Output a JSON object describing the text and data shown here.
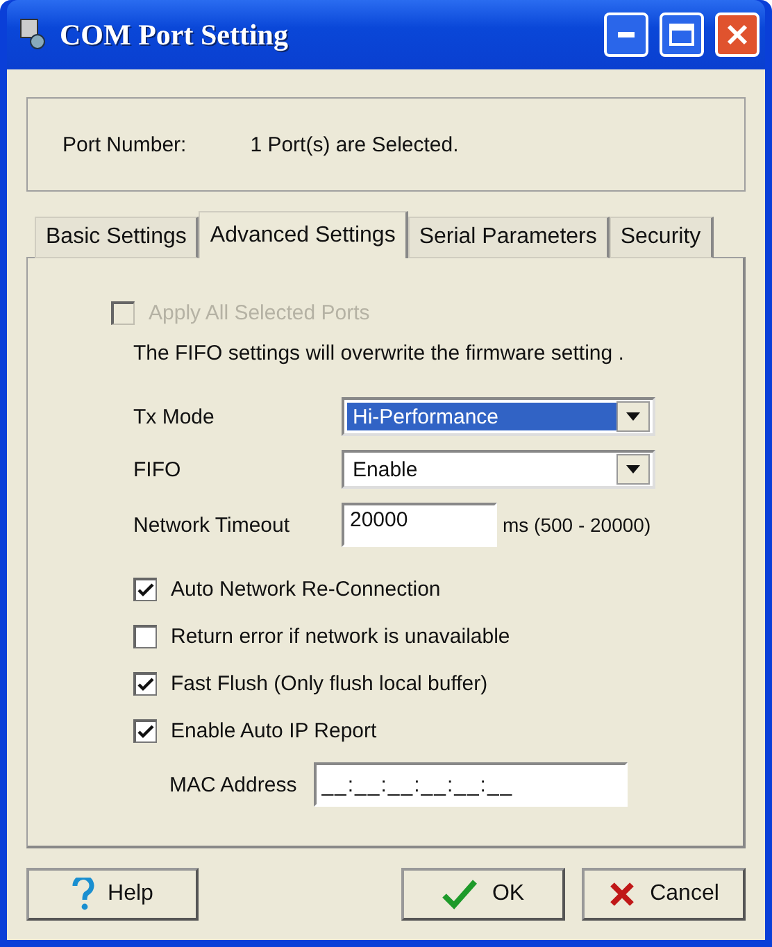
{
  "window": {
    "title": "COM Port Setting"
  },
  "port": {
    "label": "Port Number:",
    "value": "1 Port(s) are Selected."
  },
  "tabs": [
    {
      "label": "Basic Settings",
      "selected": false
    },
    {
      "label": "Advanced Settings",
      "selected": true
    },
    {
      "label": "Serial Parameters",
      "selected": false
    },
    {
      "label": "Security",
      "selected": false
    }
  ],
  "apply_all": {
    "label": "Apply All Selected Ports",
    "checked": false,
    "disabled": true
  },
  "note": "The FIFO settings will overwrite the firmware setting .",
  "tx_mode": {
    "label": "Tx Mode",
    "value": "Hi-Performance",
    "focused": true
  },
  "fifo": {
    "label": "FIFO",
    "value": "Enable",
    "focused": false
  },
  "timeout": {
    "label": "Network Timeout",
    "value": "20000",
    "hint": "ms (500 - 20000)"
  },
  "options": [
    {
      "label": "Auto Network Re-Connection",
      "checked": true
    },
    {
      "label": "Return error if network is unavailable",
      "checked": false
    },
    {
      "label": "Fast Flush (Only flush local buffer)",
      "checked": true
    },
    {
      "label": "Enable Auto IP Report",
      "checked": true
    }
  ],
  "mac": {
    "label": "MAC Address",
    "value": "__:__:__:__:__:__"
  },
  "buttons": [
    {
      "kind": "help",
      "label": "Help"
    },
    {
      "kind": "ok",
      "label": "OK"
    },
    {
      "kind": "cancel",
      "label": "Cancel"
    }
  ]
}
